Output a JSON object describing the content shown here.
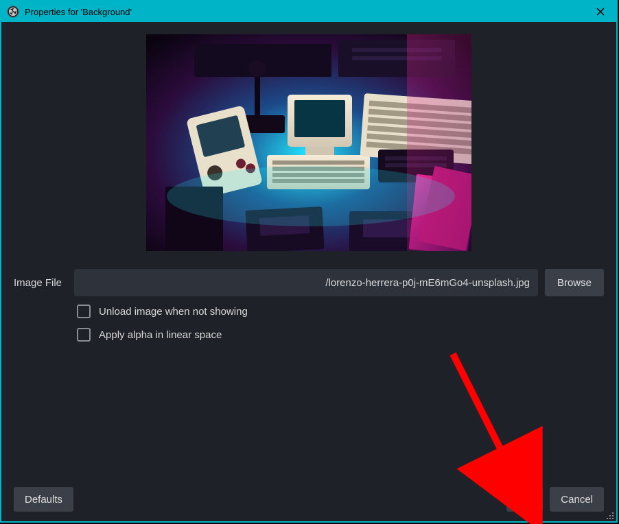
{
  "window": {
    "title": "Properties for 'Background'",
    "app_icon_name": "obs-icon",
    "close_icon_name": "close-icon"
  },
  "form": {
    "image_file_label": "Image File",
    "image_file_value": "/lorenzo-herrera-p0j-mE6mGo4-unsplash.jpg",
    "browse_label": "Browse",
    "checkboxes": [
      {
        "label": "Unload image when not showing",
        "checked": false
      },
      {
        "label": "Apply alpha in linear space",
        "checked": false
      }
    ]
  },
  "buttons": {
    "defaults": "Defaults",
    "ok": "OK",
    "cancel": "Cancel"
  },
  "colors": {
    "accent": "#00b4c8",
    "panel": "#1e2127",
    "field_bg": "#2e323a",
    "btn_bg": "#3a3f48"
  }
}
